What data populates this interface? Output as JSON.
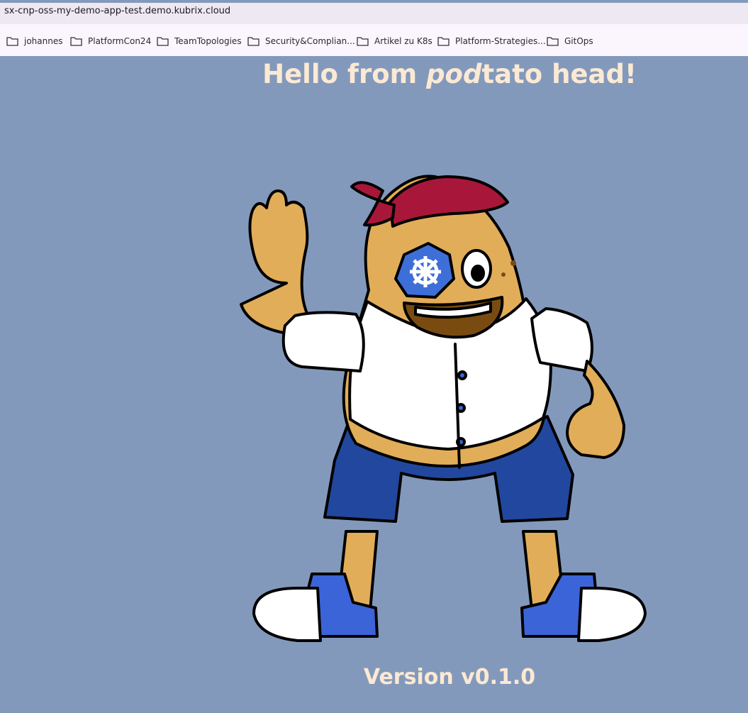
{
  "browser": {
    "url": "sx-cnp-oss-my-demo-app-test.demo.kubrix.cloud",
    "bookmarks": [
      {
        "label": "johannes",
        "icon": "folder-icon"
      },
      {
        "label": "PlatformCon24",
        "icon": "folder-icon"
      },
      {
        "label": "TeamTopologies",
        "icon": "folder-icon"
      },
      {
        "label": "Security&Complian...",
        "icon": "folder-icon"
      },
      {
        "label": "Artikel zu K8s",
        "icon": "folder-icon"
      },
      {
        "label": "Platform-Strategies...",
        "icon": "folder-icon"
      },
      {
        "label": "GitOps",
        "icon": "folder-icon"
      }
    ]
  },
  "page": {
    "title_prefix": "Hello from ",
    "title_emphasis": "pod",
    "title_suffix": "tato head!",
    "version": "Version v0.1.0",
    "background": "#8399bc",
    "text_color": "#fbe9d3"
  },
  "mascot": {
    "name": "podtato-head",
    "eyepatch_icon": "kubernetes-helm-icon"
  }
}
